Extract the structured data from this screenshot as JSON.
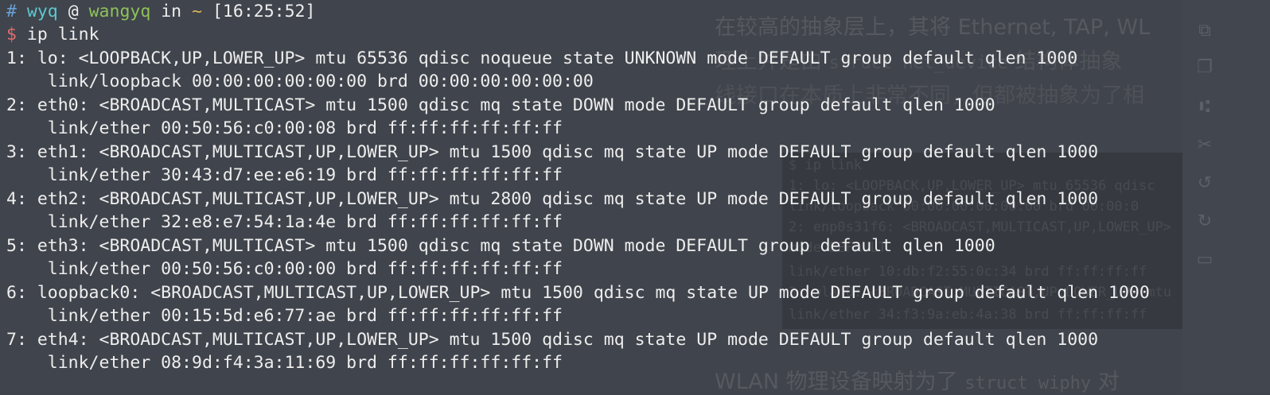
{
  "background_doc": {
    "line1": "在较高的抽象层上，其将 Ethernet, TAP, WL",
    "line2a": "理上并是由 ",
    "line2b": "struct net_device",
    "line2c": " 结构体抽象",
    "line3": "线接口在本质上非常不同，但都被抽象为了相",
    "line4a": "WLAN 物理设备映射为了 ",
    "line4b": "struct wiphy",
    "line4c": " 对",
    "code_lines": [
      "$ ip link",
      "1: lo: <LOOPBACK,UP,LOWER_UP> mtu 65536 qdisc",
      "    link/loopback 00:00:00:00:00:00 brd 00:00:0",
      "2: enp0s31f6: <BROADCAST,MULTICAST,UP,LOWER_UP>",
      "    mode DEFAULT",
      "    link/ether 10:db:f2:55:0c:34 brd ff:ff:ff:ff",
      "3: wlan0: <BROADCAST,MULTICAST,UP,LOWER_UP> mtu",
      "    link/ether 34:f3:9a:eb:4a:38 brd ff:ff:ff:ff"
    ],
    "rail_icons": [
      "copy-icon",
      "duplicate-icon",
      "share-icon",
      "cut-icon",
      "undo-icon",
      "redo-icon",
      "comment-icon"
    ]
  },
  "prompt": {
    "hash": "#",
    "user": "wyq",
    "at": "@",
    "host": "wangyq",
    "in": "in",
    "dir": "~",
    "time": "[16:25:52]",
    "dollar": "$",
    "command": "ip link"
  },
  "output_lines": [
    "1: lo: <LOOPBACK,UP,LOWER_UP> mtu 65536 qdisc noqueue state UNKNOWN mode DEFAULT group default qlen 1000",
    "    link/loopback 00:00:00:00:00:00 brd 00:00:00:00:00:00",
    "2: eth0: <BROADCAST,MULTICAST> mtu 1500 qdisc mq state DOWN mode DEFAULT group default qlen 1000",
    "    link/ether 00:50:56:c0:00:08 brd ff:ff:ff:ff:ff:ff",
    "3: eth1: <BROADCAST,MULTICAST,UP,LOWER_UP> mtu 1500 qdisc mq state UP mode DEFAULT group default qlen 1000",
    "    link/ether 30:43:d7:ee:e6:19 brd ff:ff:ff:ff:ff:ff",
    "4: eth2: <BROADCAST,MULTICAST,UP,LOWER_UP> mtu 2800 qdisc mq state UP mode DEFAULT group default qlen 1000",
    "    link/ether 32:e8:e7:54:1a:4e brd ff:ff:ff:ff:ff:ff",
    "5: eth3: <BROADCAST,MULTICAST> mtu 1500 qdisc mq state DOWN mode DEFAULT group default qlen 1000",
    "    link/ether 00:50:56:c0:00:00 brd ff:ff:ff:ff:ff:ff",
    "6: loopback0: <BROADCAST,MULTICAST,UP,LOWER_UP> mtu 1500 qdisc mq state UP mode DEFAULT group default qlen 1000",
    "    link/ether 00:15:5d:e6:77:ae brd ff:ff:ff:ff:ff:ff",
    "7: eth4: <BROADCAST,MULTICAST,UP,LOWER_UP> mtu 1500 qdisc mq state UP mode DEFAULT group default qlen 1000",
    "    link/ether 08:9d:f4:3a:11:69 brd ff:ff:ff:ff:ff:ff"
  ]
}
